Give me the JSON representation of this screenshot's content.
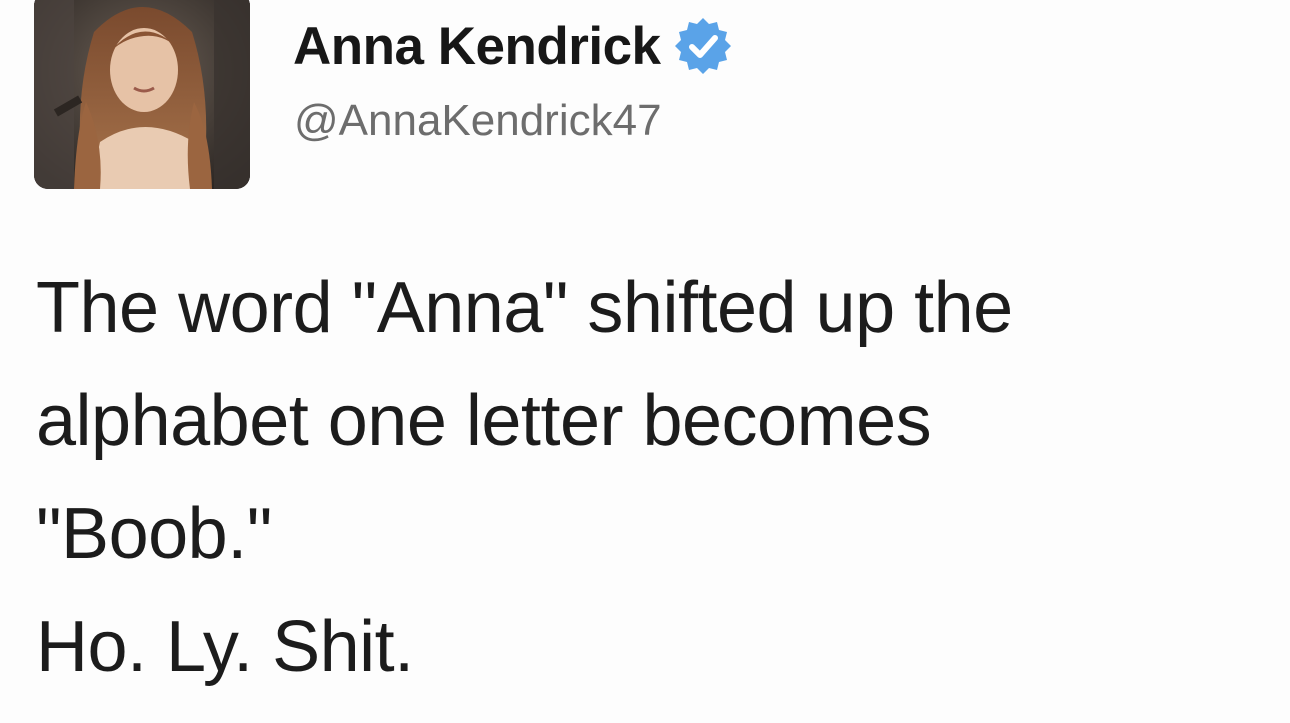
{
  "tweet": {
    "author": {
      "display_name": "Anna Kendrick",
      "handle": "@AnnaKendrick47",
      "verified_icon": "verified-badge-icon",
      "verified_color": "#5aa3e8",
      "avatar": "profile-photo"
    },
    "text_lines": [
      "The word \"Anna\" shifted up the",
      "alphabet one letter becomes",
      "\"Boob.\"",
      "Ho. Ly. Shit."
    ]
  }
}
